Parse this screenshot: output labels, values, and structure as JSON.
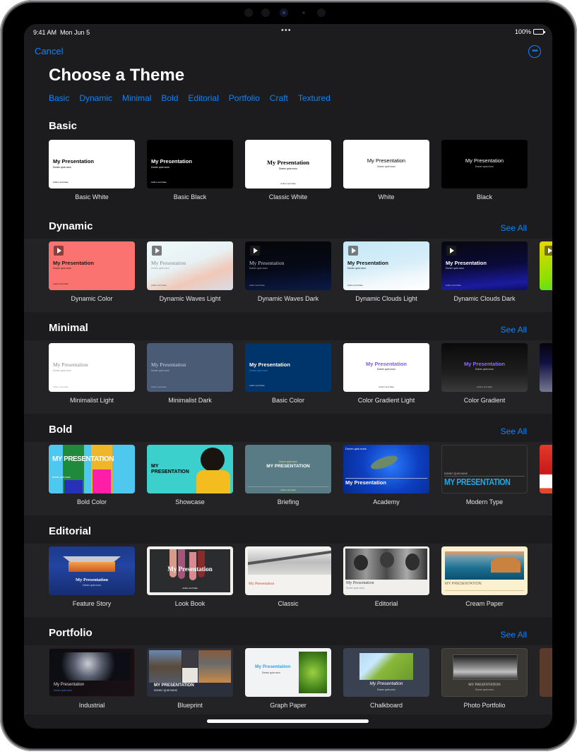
{
  "status": {
    "time": "9:41 AM",
    "date": "Mon Jun 5",
    "battery": "100%"
  },
  "nav": {
    "cancel": "Cancel",
    "more_icon": "ellipsis-circle-icon"
  },
  "title": "Choose a Theme",
  "categories": [
    "Basic",
    "Dynamic",
    "Minimal",
    "Bold",
    "Editorial",
    "Portfolio",
    "Craft",
    "Textured"
  ],
  "see_all": "See All",
  "thumb_text": {
    "title": "My Presentation",
    "title_caps": "MY PRESENTATION",
    "subtitle": "Donec quis nunc",
    "subtitle_caps": "DONEC QUIS NUNC",
    "footer": "Author and Date"
  },
  "sections": [
    {
      "title": "Basic",
      "see_all": false,
      "themes": [
        "Basic White",
        "Basic Black",
        "Classic White",
        "White",
        "Black"
      ]
    },
    {
      "title": "Dynamic",
      "see_all": true,
      "themes": [
        "Dynamic Color",
        "Dynamic Waves Light",
        "Dynamic Waves Dark",
        "Dynamic Clouds Light",
        "Dynamic Clouds Dark"
      ]
    },
    {
      "title": "Minimal",
      "see_all": true,
      "themes": [
        "Minimalist Light",
        "Minimalist Dark",
        "Basic Color",
        "Color Gradient Light",
        "Color Gradient"
      ]
    },
    {
      "title": "Bold",
      "see_all": true,
      "themes": [
        "Bold Color",
        "Showcase",
        "Briefing",
        "Academy",
        "Modern Type"
      ]
    },
    {
      "title": "Editorial",
      "see_all": false,
      "themes": [
        "Feature Story",
        "Look Book",
        "Classic",
        "Editorial",
        "Cream Paper"
      ]
    },
    {
      "title": "Portfolio",
      "see_all": true,
      "themes": [
        "Industrial",
        "Blueprint",
        "Graph Paper",
        "Chalkboard",
        "Photo Portfolio"
      ]
    }
  ],
  "colors": {
    "accent": "#0a84ff",
    "background": "#1c1c1e",
    "carousel_band": "#232325"
  }
}
